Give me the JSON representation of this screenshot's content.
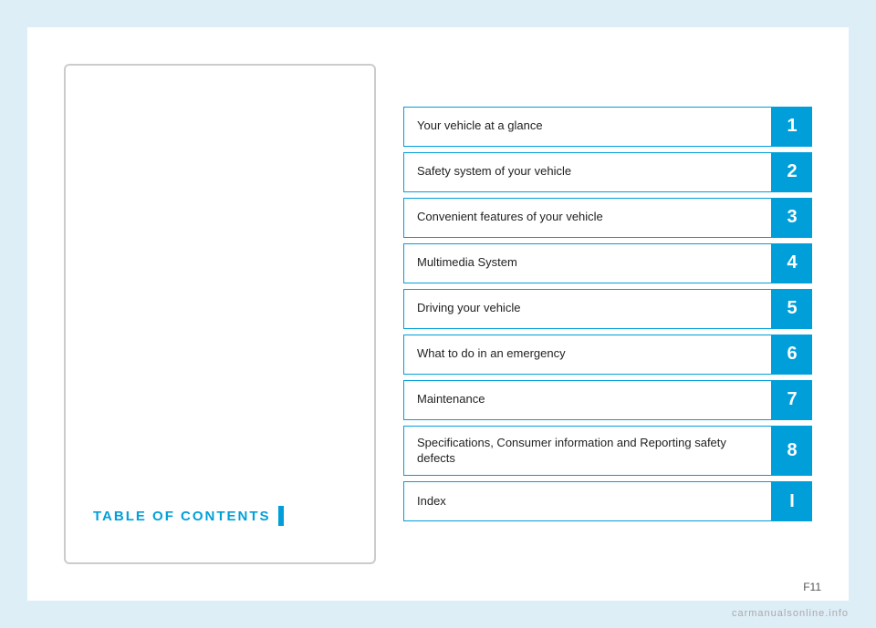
{
  "toc_title": "TABLE OF CONTENTS",
  "toc_title_bar": true,
  "items": [
    {
      "label": "Your vehicle at a glance",
      "number": "1"
    },
    {
      "label": "Safety system of your vehicle",
      "number": "2"
    },
    {
      "label": "Convenient features of your vehicle",
      "number": "3"
    },
    {
      "label": "Multimedia System",
      "number": "4"
    },
    {
      "label": "Driving your vehicle",
      "number": "5"
    },
    {
      "label": "What to do in an emergency",
      "number": "6"
    },
    {
      "label": "Maintenance",
      "number": "7"
    },
    {
      "label": "Specifications, Consumer information and Reporting safety defects",
      "number": "8"
    },
    {
      "label": "Index",
      "number": "I"
    }
  ],
  "footer": {
    "page": "F11"
  },
  "watermark": "carmanualsonline.info"
}
